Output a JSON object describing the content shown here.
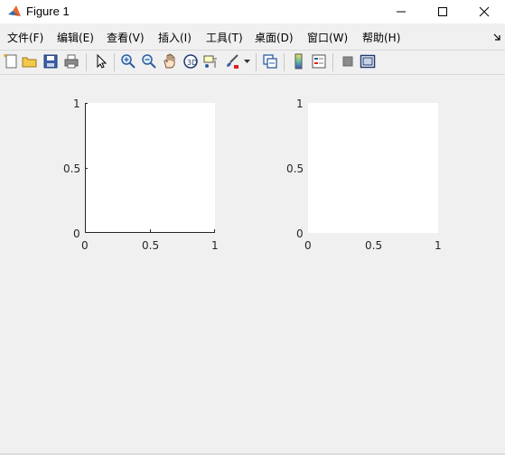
{
  "window": {
    "title": "Figure 1",
    "controls": [
      "minimize",
      "maximize",
      "close"
    ]
  },
  "menu": {
    "items": [
      {
        "label": "文件(F)"
      },
      {
        "label": "编辑(E)"
      },
      {
        "label": "查看(V)"
      },
      {
        "label": "插入(I)"
      },
      {
        "label": "工具(T)"
      },
      {
        "label": "桌面(D)"
      },
      {
        "label": "窗口(W)"
      },
      {
        "label": "帮助(H)"
      }
    ],
    "overflow_icon": "dock-arrow-icon"
  },
  "toolbar": {
    "icons": [
      "new-figure-icon",
      "open-file-icon",
      "save-icon",
      "print-icon",
      "edit-plot-icon",
      "zoom-in-icon",
      "zoom-out-icon",
      "pan-icon",
      "rotate-3d-icon",
      "data-cursor-icon",
      "brush-icon",
      "brush-dropdown-icon",
      "link-plot-icon",
      "colorbar-icon",
      "legend-icon",
      "hide-plot-tools-icon",
      "show-plot-tools-icon"
    ]
  },
  "chart_data": [
    {
      "type": "line",
      "series": [],
      "xlim": [
        0,
        1
      ],
      "ylim": [
        0,
        1
      ],
      "xticks": [
        "0",
        "0.5",
        "1"
      ],
      "yticks": [
        "0",
        "0.5",
        "1"
      ],
      "grid": false
    },
    {
      "type": "line",
      "series": [],
      "xlim": [
        0,
        1
      ],
      "ylim": [
        0,
        1
      ],
      "xticks": [
        "0",
        "0.5",
        "1"
      ],
      "yticks": [
        "0",
        "0.5",
        "1"
      ],
      "grid": false
    }
  ]
}
